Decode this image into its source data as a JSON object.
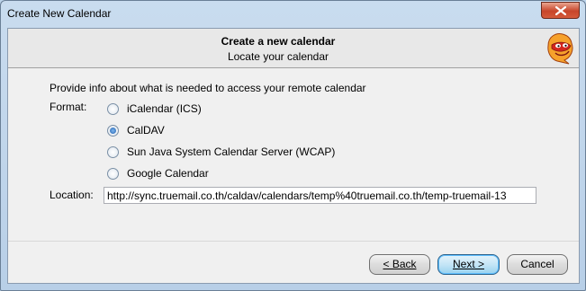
{
  "window": {
    "title": "Create New Calendar"
  },
  "banner": {
    "title": "Create a new calendar",
    "subtitle": "Locate your calendar"
  },
  "form": {
    "intro": "Provide info about what is needed to access your remote calendar",
    "format_label": "Format:",
    "options": [
      {
        "label": "iCalendar (ICS)",
        "checked": false
      },
      {
        "label": "CalDAV",
        "checked": true
      },
      {
        "label": "Sun Java System Calendar Server (WCAP)",
        "checked": false
      },
      {
        "label": "Google Calendar",
        "checked": false
      }
    ],
    "location_label": "Location:",
    "location_value": "http://sync.truemail.co.th/caldav/calendars/temp%40truemail.co.th/temp-truemail-13"
  },
  "buttons": {
    "back": "< Back",
    "next": "Next >",
    "cancel": "Cancel"
  },
  "colors": {
    "close_button": "#c7452a",
    "primary_button": "#98d1ef",
    "window_frame": "#b8cfe7"
  }
}
